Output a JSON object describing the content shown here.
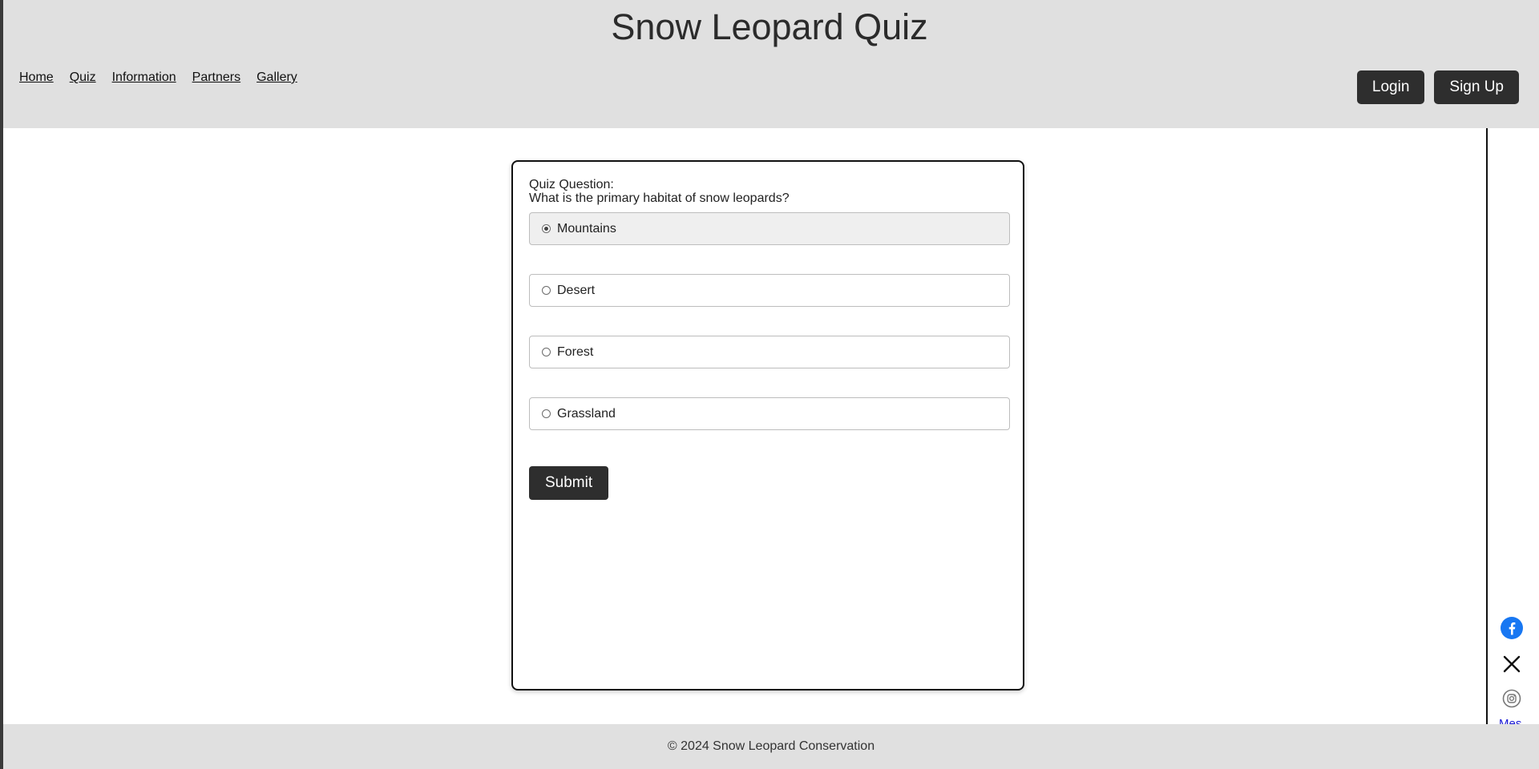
{
  "header": {
    "title": "Snow Leopard Quiz",
    "nav": [
      "Home",
      "Quiz",
      "Information",
      "Partners",
      "Gallery"
    ],
    "login_label": "Login",
    "signup_label": "Sign Up"
  },
  "quiz": {
    "label": "Quiz Question:",
    "question": "What is the primary habitat of snow leopards?",
    "options": [
      "Mountains",
      "Desert",
      "Forest",
      "Grassland"
    ],
    "selected_option": "Mountains",
    "submit_label": "Submit"
  },
  "social": {
    "icons": [
      "facebook-icon",
      "x-icon",
      "instagram-icon",
      "messenger-icon"
    ],
    "broken_image_alt": "Mes"
  },
  "footer": {
    "text": "© 2024 Snow Leopard Conservation"
  },
  "colors": {
    "header_bg": "#e0e0e0",
    "button_bg": "#2e2e2e",
    "facebook_blue": "#1877f2"
  }
}
